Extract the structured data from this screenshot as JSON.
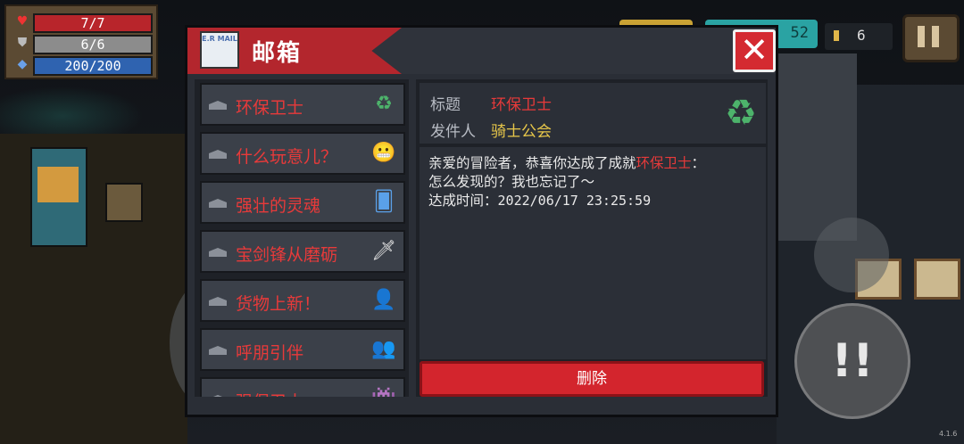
{
  "hud": {
    "hp": "7/7",
    "armor": "6/6",
    "energy": "200/200",
    "hp_icon": "heart-icon",
    "armor_icon": "shield-icon",
    "energy_icon": "diamond-icon",
    "coins": "6",
    "partial_counter": "52"
  },
  "mail": {
    "title": "邮箱",
    "mail_icon_text": "E.R MAIL",
    "close_label": "✕",
    "items": [
      {
        "label": "环保卫士",
        "icon": "recycle-icon",
        "glyph": "♻"
      },
      {
        "label": "什么玩意儿？",
        "icon": "face-icon",
        "glyph": "😬"
      },
      {
        "label": "强壮的灵魂",
        "icon": "card-icon",
        "glyph": "🂠"
      },
      {
        "label": "宝剑锋从磨砺",
        "icon": "sword-icon",
        "glyph": "🗡"
      },
      {
        "label": "货物上新！",
        "icon": "merchant-icon",
        "glyph": "👤"
      },
      {
        "label": "呼朋引伴",
        "icon": "party-icon",
        "glyph": "👥"
      },
      {
        "label": "强保卫士",
        "icon": "creature-icon",
        "glyph": "👾"
      }
    ],
    "detail": {
      "subject_label": "标题",
      "subject_value": "环保卫士",
      "sender_label": "发件人",
      "sender_value": "骑士公会",
      "body_prefix": "亲爱的冒险者，恭喜你达成了成就",
      "body_highlight": "环保卫士",
      "body_suffix": "：",
      "body_line2": "怎么发现的？我也忘记了～",
      "body_line3_label": "达成时间：",
      "body_line3_date": "2022/06/17 23:25:59"
    },
    "delete_label": "删除"
  },
  "version": "4.1.6",
  "colors": {
    "accent": "#d3252d",
    "highlight": "#e83a3a",
    "sender": "#e8c84a"
  }
}
